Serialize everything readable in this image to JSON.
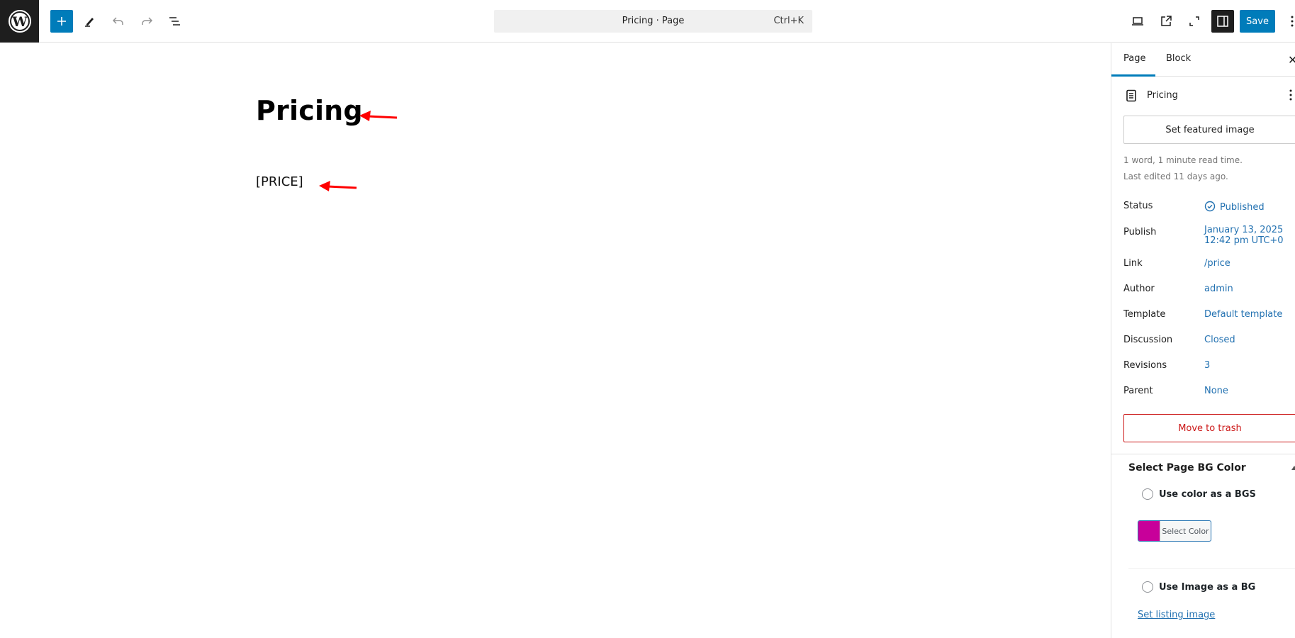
{
  "header": {
    "logo": "wordpress-logo",
    "inserter_icon": "plus-icon",
    "tools_icon": "pencil-icon",
    "undo_icon": "undo-icon",
    "redo_icon": "redo-icon",
    "list_view_icon": "list-view-icon",
    "command_bar": {
      "title": "Pricing · Page",
      "shortcut": "Ctrl+K"
    },
    "view_icon": "desktop-icon",
    "preview_icon": "external-link-icon",
    "fullscreen_icon": "fullscreen-icon",
    "settings_icon": "sidebar-toggle-icon",
    "save_label": "Save",
    "more_icon": "kebab-icon"
  },
  "canvas": {
    "title": "Pricing",
    "content": "[PRICE]",
    "annotation_color": "#ff0000"
  },
  "sidebar": {
    "tabs": [
      {
        "label": "Page",
        "active": true
      },
      {
        "label": "Block",
        "active": false
      }
    ],
    "document": {
      "icon": "page-icon",
      "title": "Pricing"
    },
    "featured_image_label": "Set featured image",
    "word_count": "1 word, 1 minute read time.",
    "last_edited": "Last edited 11 days ago.",
    "rows": [
      {
        "label": "Status",
        "value": "Published"
      },
      {
        "label": "Publish",
        "value": "January 13, 2025",
        "value2": "12:42 pm UTC+0"
      },
      {
        "label": "Link",
        "value": "/price"
      },
      {
        "label": "Author",
        "value": "admin"
      },
      {
        "label": "Template",
        "value": "Default template"
      },
      {
        "label": "Discussion",
        "value": "Closed"
      },
      {
        "label": "Revisions",
        "value": "3"
      },
      {
        "label": "Parent",
        "value": "None"
      }
    ],
    "trash_label": "Move to trash",
    "bg_panel": {
      "title": "Select Page BG Color",
      "use_color_label": "Use color as a BGS",
      "select_color_label": "Select Color",
      "selected_color": "#c8009a",
      "use_image_label": "Use Image as a BG",
      "listing_image_link": "Set listing image"
    }
  },
  "colors": {
    "accent": "#007cba",
    "link": "#2271b1",
    "danger": "#cc1818"
  }
}
